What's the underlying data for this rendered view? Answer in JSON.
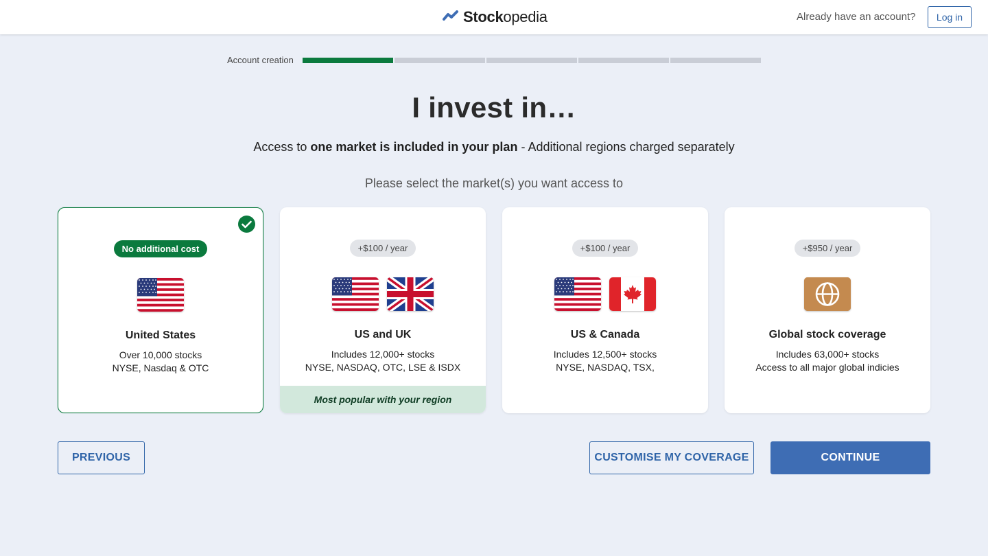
{
  "header": {
    "logo_bold": "Stock",
    "logo_regular": "opedia",
    "already_text": "Already have an account?",
    "login_label": "Log in"
  },
  "progress": {
    "label": "Account creation",
    "steps_total": 5,
    "steps_completed": 1
  },
  "main": {
    "title": "I invest in…",
    "subtitle_pre": "Access to ",
    "subtitle_bold": "one market is included in your plan",
    "subtitle_post": " - Additional regions charged separately",
    "prompt": "Please select the market(s) you want access to"
  },
  "cards": [
    {
      "badge": "No additional cost",
      "title": "United States",
      "line1": "Over 10,000 stocks",
      "line2": "NYSE, Nasdaq & OTC",
      "flags": [
        "us-flag-icon"
      ],
      "selected": true
    },
    {
      "badge": "+$100 / year",
      "title": "US and UK",
      "line1": "Includes 12,000+ stocks",
      "line2": "NYSE, NASDAQ, OTC, LSE & ISDX",
      "flags": [
        "us-flag-icon",
        "uk-flag-icon"
      ],
      "footer": "Most popular with your region"
    },
    {
      "badge": "+$100 / year",
      "title": "US & Canada",
      "line1": "Includes 12,500+ stocks",
      "line2": "NYSE, NASDAQ, TSX,",
      "flags": [
        "us-flag-icon",
        "canada-flag-icon"
      ]
    },
    {
      "badge": "+$950 / year",
      "title": "Global stock coverage",
      "line1": "Includes 63,000+ stocks",
      "line2": "Access to all major global indicies",
      "flags": [
        "globe-icon"
      ]
    }
  ],
  "actions": {
    "previous": "PREVIOUS",
    "customise": "CUSTOMISE MY COVERAGE",
    "continue": "CONTINUE"
  },
  "colors": {
    "accent_green": "#0b7a3e",
    "accent_blue": "#3e6db4",
    "background": "#ebeff7",
    "globe_tile": "#c48a4f"
  }
}
